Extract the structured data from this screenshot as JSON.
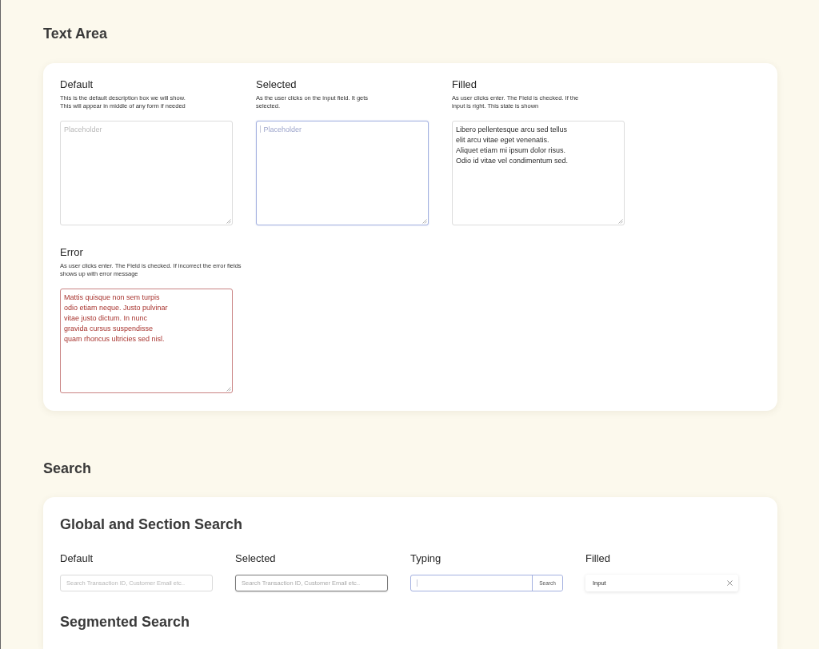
{
  "text_area": {
    "title": "Text Area",
    "fields": [
      {
        "kind": "default",
        "label": "Default",
        "description": [
          "This is the default description box we will show.",
          "This will appear in middle of any form if needed"
        ],
        "placeholder": "Placeholder",
        "caret": false
      },
      {
        "kind": "selected",
        "label": "Selected",
        "description": [
          "As the user clicks on the input field. It gets",
          "selected."
        ],
        "placeholder": "Placeholder",
        "caret": true
      },
      {
        "kind": "filled",
        "label": "Filled",
        "description": [
          "As user clicks enter. The Field is checked. If the",
          "input is right. This state is shown"
        ],
        "value_lines": [
          "Libero pellentesque arcu sed tellus",
          "elit arcu vitae eget venenatis.",
          "Aliquet etiam mi ipsum dolor risus.",
          "Odio id vitae vel condimentum sed."
        ],
        "caret": false
      },
      {
        "kind": "error",
        "label": "Error",
        "description": [
          "As user clicks enter. The Field is checked. If incorrect the error fields",
          "shows up with error message"
        ],
        "value_lines": [
          "Mattis quisque non sem turpis",
          "odio etiam neque. Justo pulvinar",
          "vitae justo dictum. In nunc",
          "gravida cursus suspendisse",
          "quam rhoncus ultricies sed nisl."
        ],
        "caret": false
      }
    ]
  },
  "search": {
    "title": "Search",
    "card": {
      "title": "Global and Section Search",
      "fields": [
        {
          "kind": "default",
          "label": "Default",
          "placeholder": "Search Transaction ID, Customer Email etc..",
          "caret": false
        },
        {
          "kind": "selected",
          "label": "Selected",
          "placeholder": "Search Transaction ID, Customer Email etc..",
          "caret": false
        },
        {
          "kind": "typing",
          "label": "Typing",
          "button": "Search",
          "caret": true
        },
        {
          "kind": "filled",
          "label": "Filled",
          "value": "Input"
        }
      ],
      "subtitle": "Segmented Search"
    }
  }
}
